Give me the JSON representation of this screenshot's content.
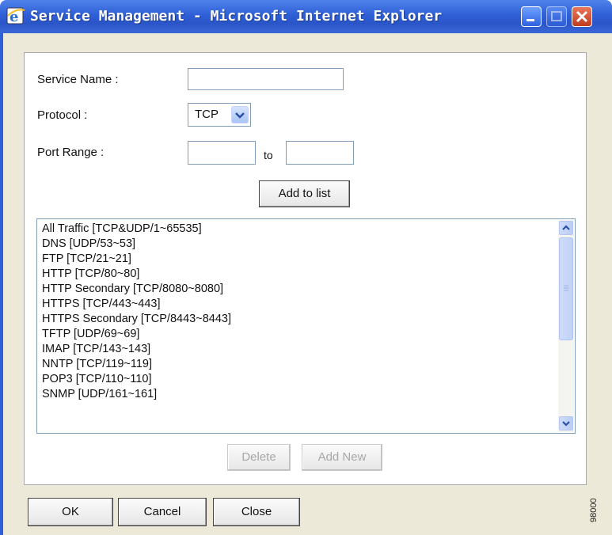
{
  "window": {
    "title": "Service Management - Microsoft Internet Explorer"
  },
  "form": {
    "service_name_label": "Service Name :",
    "service_name_value": "",
    "protocol_label": "Protocol :",
    "protocol_selected": "TCP",
    "port_range_label": "Port Range :",
    "port_from_value": "",
    "port_to_label": "to",
    "port_to_value": "",
    "add_to_list_label": "Add to list"
  },
  "services": [
    "All Traffic [TCP&UDP/1~65535]",
    "DNS [UDP/53~53]",
    "FTP [TCP/21~21]",
    "HTTP [TCP/80~80]",
    "HTTP Secondary [TCP/8080~8080]",
    "HTTPS [TCP/443~443]",
    "HTTPS Secondary [TCP/8443~8443]",
    "TFTP [UDP/69~69]",
    "IMAP [TCP/143~143]",
    "NNTP [TCP/119~119]",
    "POP3 [TCP/110~110]",
    "SNMP [UDP/161~161]"
  ],
  "list_actions": {
    "delete_label": "Delete",
    "add_new_label": "Add New"
  },
  "footer": {
    "ok_label": "OK",
    "cancel_label": "Cancel",
    "close_label": "Close"
  },
  "watermark": "98000",
  "icons": {
    "app": "ie-icon",
    "minimize": "minimize-icon",
    "maximize": "maximize-icon",
    "close": "close-icon",
    "dropdown": "chevron-down-icon",
    "scroll_up": "scroll-up-icon",
    "scroll_down": "scroll-down-icon"
  },
  "colors": {
    "titlebar": "#2f5fd6",
    "close_button": "#c13d1e",
    "frame": "#ece9d8"
  }
}
